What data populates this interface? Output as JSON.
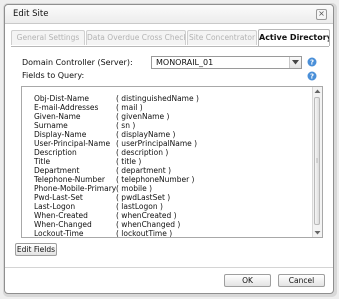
{
  "dialog": {
    "title": "Edit Site"
  },
  "tabs": [
    {
      "label": "General Settings",
      "active": false
    },
    {
      "label": "Data Overdue Cross Check",
      "active": false
    },
    {
      "label": "Site Concentrator",
      "active": false
    },
    {
      "label": "Active Directory",
      "active": true
    }
  ],
  "domain_controller": {
    "label": "Domain Controller (Server):",
    "value": "MONORAIL_01",
    "icon": "chevron-down-icon"
  },
  "fields_to_query": {
    "label": "Fields to Query:",
    "items": [
      {
        "name": "Obj-Dist-Name",
        "attr": "( distinguishedName )"
      },
      {
        "name": "E-mail-Addresses",
        "attr": "( mail )"
      },
      {
        "name": "Given-Name",
        "attr": "( givenName )"
      },
      {
        "name": "Surname",
        "attr": "( sn )"
      },
      {
        "name": "Display-Name",
        "attr": "( displayName )"
      },
      {
        "name": "User-Principal-Name",
        "attr": "( userPrincipalName )"
      },
      {
        "name": "Description",
        "attr": "( description )"
      },
      {
        "name": "Title",
        "attr": "( title )"
      },
      {
        "name": "Department",
        "attr": "( department )"
      },
      {
        "name": "Telephone-Number",
        "attr": "( telephoneNumber )"
      },
      {
        "name": "Phone-Mobile-Primary",
        "attr": "( mobile )"
      },
      {
        "name": "Pwd-Last-Set",
        "attr": "( pwdLastSet )"
      },
      {
        "name": "Last-Logon",
        "attr": "( lastLogon )"
      },
      {
        "name": "When-Created",
        "attr": "( whenCreated )"
      },
      {
        "name": "When-Changed",
        "attr": "( whenChanged )"
      },
      {
        "name": "Lockout-Time",
        "attr": "( lockoutTime )"
      }
    ]
  },
  "buttons": {
    "edit_fields": "Edit Fields",
    "ok": "OK",
    "cancel": "Cancel"
  },
  "icons": {
    "help": "help-icon",
    "close": "close-icon"
  },
  "colors": {
    "help_icon": "#4a8fd8",
    "active_tab_text": "#111111",
    "inactive_tab_text": "#b3b3b3"
  }
}
